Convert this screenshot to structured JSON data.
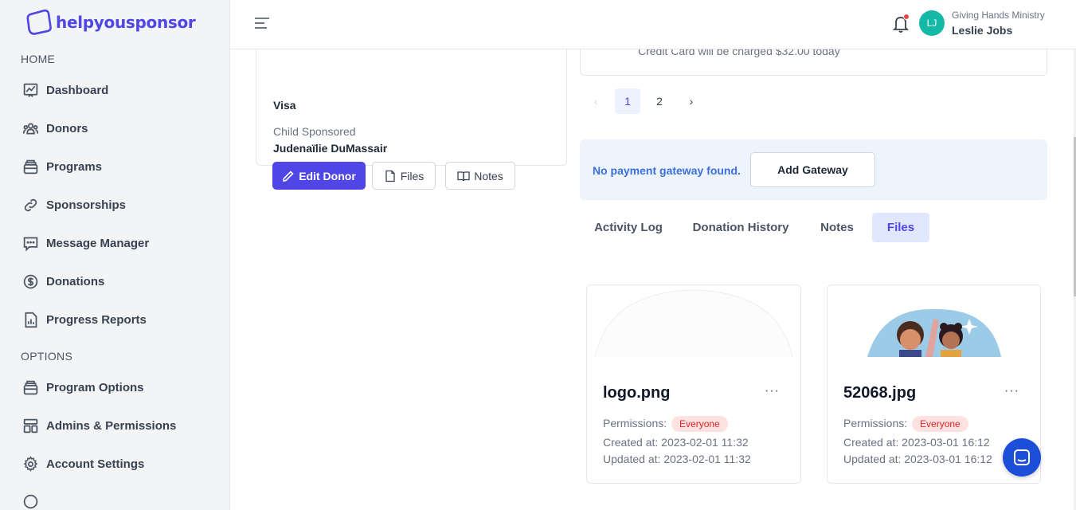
{
  "brand": {
    "name": "helpyousponsor"
  },
  "sidebar": {
    "sections": [
      {
        "title": "HOME"
      },
      {
        "title": "OPTIONS"
      }
    ],
    "items": [
      {
        "label": "Dashboard",
        "icon": "chart-icon"
      },
      {
        "label": "Donors",
        "icon": "users-icon"
      },
      {
        "label": "Programs",
        "icon": "stack-icon"
      },
      {
        "label": "Sponsorships",
        "icon": "link-icon"
      },
      {
        "label": "Message Manager",
        "icon": "message-icon"
      },
      {
        "label": "Donations",
        "icon": "dollar-icon"
      },
      {
        "label": "Progress Reports",
        "icon": "report-icon"
      },
      {
        "label": "Program Options",
        "icon": "stack-icon"
      },
      {
        "label": "Admins & Permissions",
        "icon": "layout-icon"
      },
      {
        "label": "Account Settings",
        "icon": "gear-icon"
      }
    ]
  },
  "header": {
    "org": "Giving Hands Ministry",
    "user": "Leslie Jobs",
    "initials": "LJ"
  },
  "donor": {
    "card_type": "Visa",
    "child_label": "Child Sponsored",
    "child_name": "Judenaïlie DuMassair",
    "edit_label": "Edit Donor",
    "files_label": "Files",
    "notes_label": "Notes"
  },
  "summary": {
    "text": "Credit Card will be charged $32.00 today"
  },
  "pagination": {
    "prev": "‹",
    "pages": [
      "1",
      "2"
    ],
    "next": "›",
    "current": "1"
  },
  "gateway": {
    "message": "No payment gateway found.",
    "button": "Add Gateway"
  },
  "tabs": [
    {
      "label": "Activity Log"
    },
    {
      "label": "Donation History"
    },
    {
      "label": "Notes"
    },
    {
      "label": "Files",
      "active": true
    }
  ],
  "files": [
    {
      "name": "logo.png",
      "permissions_label": "Permissions:",
      "permission": "Everyone",
      "created": "Created at: 2023-02-01 11:32",
      "updated": "Updated at: 2023-02-01 11:32",
      "menu": "···"
    },
    {
      "name": "52068.jpg",
      "permissions_label": "Permissions:",
      "permission": "Everyone",
      "created": "Created at: 2023-03-01 16:12",
      "updated": "Updated at: 2023-03-01 16:12",
      "menu": "···"
    }
  ],
  "colors": {
    "brand": "#4f46e5",
    "avatar": "#14b8a6",
    "badge": "#dc2626",
    "chat": "#1d4ed8"
  }
}
